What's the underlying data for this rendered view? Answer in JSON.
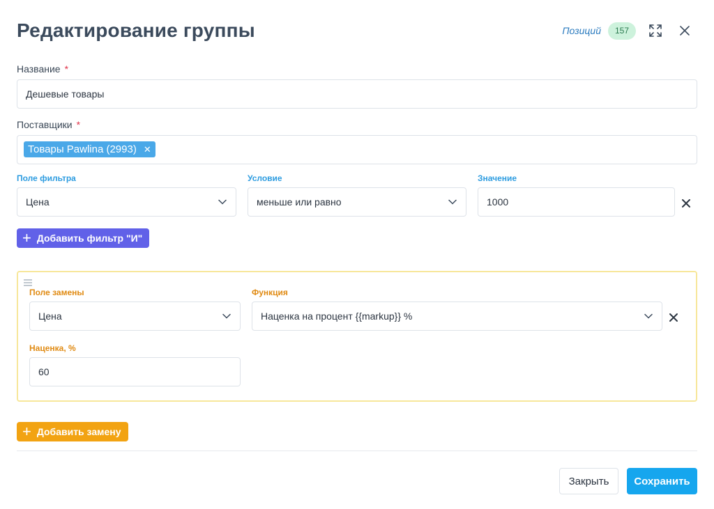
{
  "dialog": {
    "title": "Редактирование группы",
    "positions_label": "Позиций",
    "positions_count": "157"
  },
  "form": {
    "name_label": "Название",
    "name_value": "Дешевые товары",
    "suppliers_label": "Поставщики",
    "supplier_tag": "Товары Pawlina (2993)",
    "required_mark": "*"
  },
  "filter": {
    "field_label": "Поле фильтра",
    "field_value": "Цена",
    "condition_label": "Условие",
    "condition_value": "меньше или равно",
    "value_label": "Значение",
    "value_value": "1000",
    "add_and_label": "Добавить фильтр \"И\""
  },
  "replacement": {
    "field_label": "Поле замены",
    "field_value": "Цена",
    "function_label": "Функция",
    "function_value": "Наценка на процент {{markup}} %",
    "markup_label": "Наценка, %",
    "markup_value": "60",
    "add_label": "Добавить замену"
  },
  "footer": {
    "close_label": "Закрыть",
    "save_label": "Сохранить"
  },
  "colors": {
    "accent_blue": "#16a6ee",
    "purple": "#6161e8",
    "orange": "#f2a312",
    "badge_green": "#cdf2dc"
  },
  "icons": {
    "expand": "expand-icon",
    "close": "close-icon",
    "chevron": "chevron-down-icon",
    "remove": "remove-icon",
    "plus": "plus-icon",
    "drag": "drag-handle-icon"
  }
}
